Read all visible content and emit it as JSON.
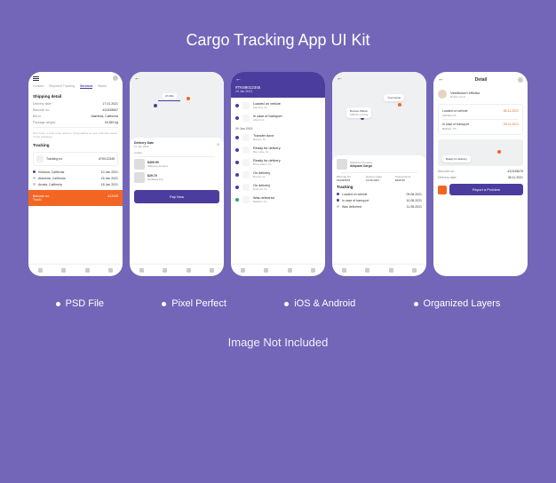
{
  "title": "Cargo Tracking App UI Kit",
  "features": [
    "PSD File",
    "Pixel Perfect",
    "iOS & Android",
    "Organized Layers"
  ],
  "footer": "Image Not Included",
  "colors": {
    "primary": "#4b3d9e",
    "accent": "#f26522",
    "bg": "#7366b8"
  },
  "screen1": {
    "tabs": [
      "Contact",
      "Shipment Tracking",
      "Services",
      "Brand"
    ],
    "section": "Shipping detail",
    "delivery_date_label": "Delivery date:",
    "delivery_date": "17.01.2021",
    "barcode_label": "Barcode no:",
    "barcode": "#12345667",
    "bill_label": "Bill to:",
    "bill": "Alameda, California",
    "weight_label": "Package weight:",
    "weight": "18.350 kg",
    "desc": "Nom tortor ut ante sodis posuere. Suspendisse ac quis vehicula massa. In hac habitasse.",
    "tracking_section": "Tracking",
    "tracking_no_label": "Tracking no",
    "tracking_no": "#TK012345",
    "timeline": [
      {
        "place": "Kirkland, California",
        "date": "10 Jan 2021"
      },
      {
        "place": "Alameda, California",
        "date": "15 Jan 2021"
      },
      {
        "place": "Arcata, California",
        "date": "18 Jan 2021"
      }
    ],
    "banner_label": "Barcode no:",
    "banner_value": "#12345",
    "banner_sub": "Track!"
  },
  "screen2": {
    "map_time": "2h 30m",
    "delivery_date_label": "Delivery Date",
    "delivery_date": "12 Jan 2021",
    "place": "Arcata",
    "amount": "$499.99",
    "amount_label": "Shipping Amount",
    "fee": "$29.79",
    "fee_label": "Handling Fee",
    "pay_btn": "Pay Now"
  },
  "screen3": {
    "id": "#TK89012345",
    "date_top": "19 Jan 2021",
    "events_top": [
      {
        "title": "Loaded on vehicle",
        "sub": "Alachua, FL"
      },
      {
        "title": "In case of transport",
        "sub": "Alford, FL"
      }
    ],
    "date_mid": "20 Jan 2021",
    "events_mid": [
      {
        "title": "Transfer done",
        "sub": "Bartow, FL"
      },
      {
        "title": "Ready for delivery",
        "sub": "Bay Lake, FL"
      },
      {
        "title": "Ready for delivery",
        "sub": "Boca Raton, FL"
      },
      {
        "title": "On delivery",
        "sub": "Bonita, FL"
      },
      {
        "title": "On delivery",
        "sub": "Bushnel, FL"
      },
      {
        "title": "Was delivered",
        "sub": "Baldwin, FL"
      }
    ]
  },
  "screen4": {
    "map_label1": "Ronson Wilson",
    "map_label2": "Your Home",
    "map_sub": "Atlantic coming",
    "company_label": "Shipping Company",
    "company": "Aliquam Cargo",
    "cols": {
      "barcode_l": "Barcode No",
      "barcode": "#12345678",
      "date_l": "Delivery Date",
      "date": "12.06.2021",
      "amount_l": "Total Amount",
      "amount": "$499.99"
    },
    "tracking_section": "Tracking",
    "events": [
      {
        "title": "Loaded on vehicle",
        "date": "09.08.2021"
      },
      {
        "title": "In case of transport",
        "date": "10.08.2021"
      },
      {
        "title": "Was delivered",
        "date": "11.08.2021"
      }
    ]
  },
  "screen5": {
    "title": "Detail",
    "user": "Vestibulum efficitur",
    "user_sub": "Doctor, lor et",
    "events": [
      {
        "title": "Loaded on vehicle",
        "sub": "Alachua, FL",
        "date": "08.11.2021"
      },
      {
        "title": "In case of transport",
        "sub": "Bethlen, TX",
        "date": "09.11.2021"
      }
    ],
    "map_label": "Ready for delivery",
    "barcode_l": "Barcode no:",
    "barcode": "#12345678",
    "delivery_l": "Delivery date:",
    "delivery": "08.11.2021",
    "report_btn": "Report a Problem"
  }
}
